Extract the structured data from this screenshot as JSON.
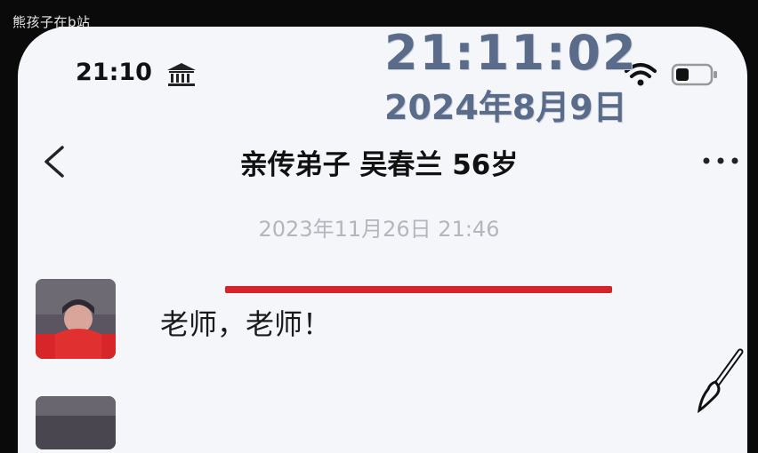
{
  "caption": "熊孩子在b站",
  "status_bar": {
    "time": "21:10",
    "icons": [
      "bank-icon",
      "wifi-icon",
      "battery-icon"
    ]
  },
  "overlay": {
    "time": "21:11:02",
    "date": "2024年8月9日"
  },
  "chat": {
    "title": "亲传弟子 吴春兰 56岁",
    "timestamp": "2023年11月26日 21:46",
    "messages": [
      {
        "text": "老师，老师！"
      }
    ]
  },
  "colors": {
    "underline": "#d8232c",
    "overlay_text": "#5b6b8a",
    "background": "#f5f6fa"
  }
}
